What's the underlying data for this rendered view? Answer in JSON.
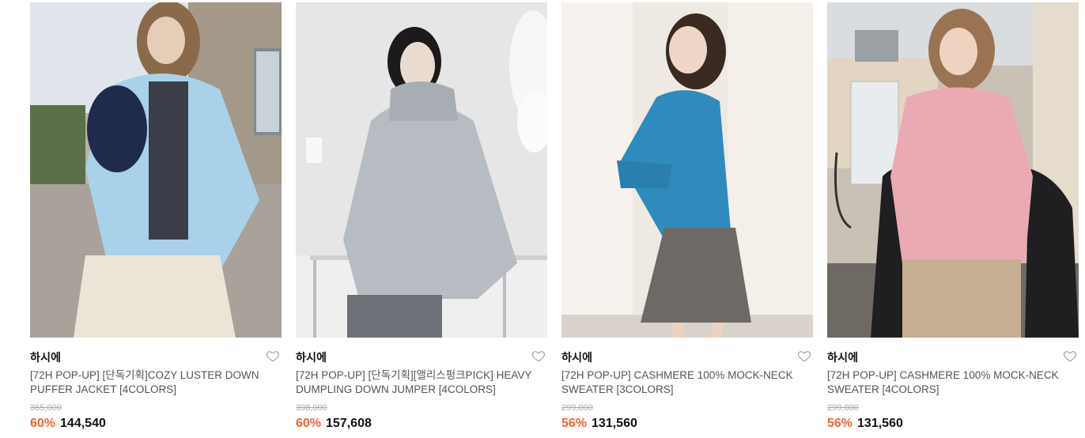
{
  "products": [
    {
      "brand": "하시에",
      "title": "[72H POP-UP] [단독기획]COZY LUSTER DOWN PUFFER JACKET [4COLORS]",
      "original_price": "365,000",
      "discount": "60%",
      "price": "144,540",
      "wishlist_icon": "heart-outline-icon",
      "image_colors": {
        "bg": "#b9b2a6",
        "sky": "#dfe5ea",
        "wall": "#a49888",
        "garment": "#a9d2ea",
        "skirt": "#ece4d6"
      }
    },
    {
      "brand": "하시에",
      "title": "[72H POP-UP] [단독기획][앨리스펑크PICK] HEAVY DUMPLING DOWN JUMPER [4COLORS]",
      "original_price": "398,000",
      "discount": "60%",
      "price": "157,608",
      "wishlist_icon": "heart-outline-icon",
      "image_colors": {
        "bg": "#efefef",
        "wall": "#e6e6e6",
        "garment": "#b6bcc2",
        "jeans": "#6e7178"
      }
    },
    {
      "brand": "하시에",
      "title": "[72H POP-UP] CASHMERE 100% MOCK-NECK SWEATER [3COLORS]",
      "original_price": "299,000",
      "discount": "56%",
      "price": "131,560",
      "wishlist_icon": "heart-outline-icon",
      "image_colors": {
        "bg": "#efe9e3",
        "curtain": "#f6f2ee",
        "garment": "#2f8bbd",
        "skirt": "#6d6a66"
      }
    },
    {
      "brand": "하시에",
      "title": "[72H POP-UP] CASHMERE 100% MOCK-NECK SWEATER [4COLORS]",
      "original_price": "299,000",
      "discount": "56%",
      "price": "131,560",
      "wishlist_icon": "heart-outline-icon",
      "image_colors": {
        "bg": "#c9c1b5",
        "sky": "#d9dde0",
        "wall": "#e2d6c3",
        "garment": "#eaaab4",
        "coat": "#1f1f22",
        "skirt": "#c6ae92"
      }
    }
  ]
}
